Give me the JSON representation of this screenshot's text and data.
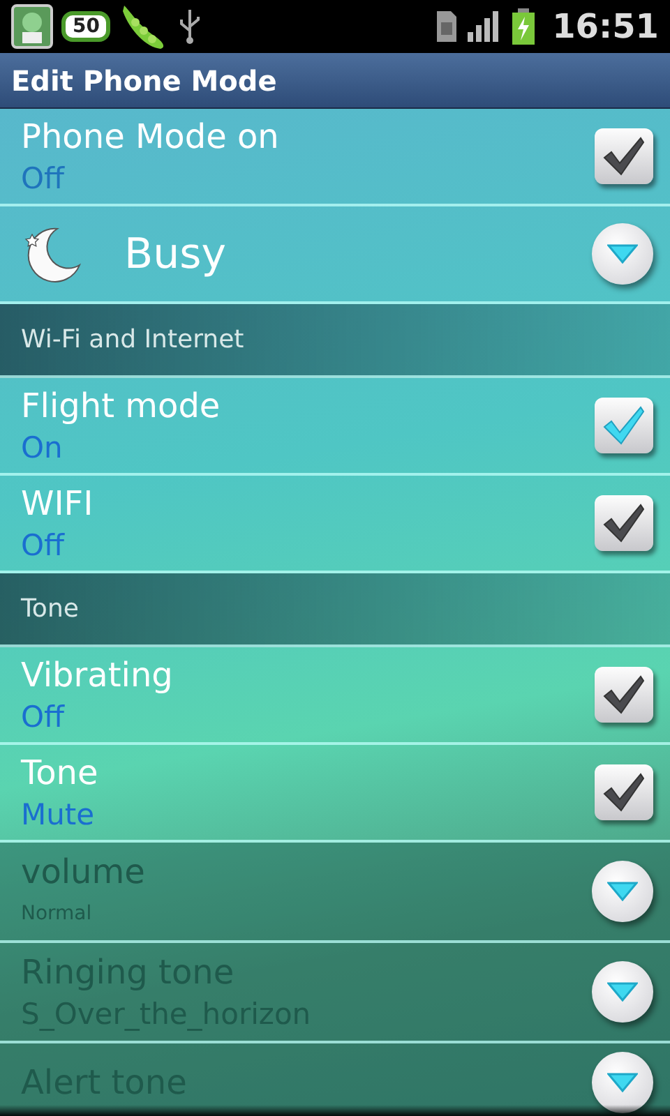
{
  "status_bar": {
    "badge": "50",
    "time": "16:51"
  },
  "title": "Edit Phone Mode",
  "items": [
    {
      "kind": "checkbox",
      "label": "Phone Mode on",
      "value": "Off",
      "checked": true,
      "focused": false,
      "disabled": false
    },
    {
      "kind": "mode",
      "label": "Busy"
    },
    {
      "kind": "header",
      "label": "Wi-Fi and Internet"
    },
    {
      "kind": "checkbox",
      "label": "Flight mode",
      "value": "On",
      "checked": true,
      "focused": true,
      "disabled": false
    },
    {
      "kind": "checkbox",
      "label": "WIFI",
      "value": "Off",
      "checked": true,
      "focused": false,
      "disabled": false
    },
    {
      "kind": "header",
      "label": "Tone"
    },
    {
      "kind": "checkbox",
      "label": "Vibrating",
      "value": "Off",
      "checked": true,
      "focused": false,
      "disabled": false
    },
    {
      "kind": "checkbox",
      "label": "Tone",
      "value": "Mute",
      "checked": true,
      "focused": false,
      "disabled": false
    },
    {
      "kind": "dropdown",
      "label": "volume",
      "value": "Normal",
      "small": true,
      "disabled": true
    },
    {
      "kind": "dropdown",
      "label": "Ringing tone",
      "value": "S_Over_the_horizon",
      "small": false,
      "disabled": true
    },
    {
      "kind": "dropdown",
      "label": "Alert tone",
      "disabled": true
    }
  ]
}
